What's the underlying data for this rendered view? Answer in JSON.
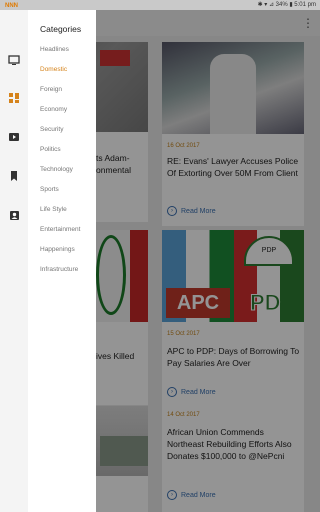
{
  "status": {
    "logo": "NNN",
    "right": "✱ ▾ ⊿ 34% ▮ 5:01 pm"
  },
  "drawer": {
    "title": "Categories",
    "items": [
      {
        "label": "Headlines",
        "active": false
      },
      {
        "label": "Domestic",
        "active": true
      },
      {
        "label": "Foreign",
        "active": false
      },
      {
        "label": "Economy",
        "active": false
      },
      {
        "label": "Security",
        "active": false
      },
      {
        "label": "Politics",
        "active": false
      },
      {
        "label": "Technology",
        "active": false
      },
      {
        "label": "Sports",
        "active": false
      },
      {
        "label": "Life Style",
        "active": false
      },
      {
        "label": "Entertainment",
        "active": false
      },
      {
        "label": "Happenings",
        "active": false
      },
      {
        "label": "Infrastructure",
        "active": false
      }
    ],
    "rail_icons": [
      "tv-icon",
      "grid-icon",
      "video-icon",
      "bookmark-icon",
      "account-icon"
    ]
  },
  "articles": {
    "left": [
      {
        "title_fragment": "ts Adam-\nonmental"
      },
      {
        "title_fragment": "ives Killed"
      }
    ],
    "right": [
      {
        "date": "16 Oct 2017",
        "title": "RE: Evans' Lawyer Accuses Police Of Extorting Over 50M From Client",
        "readmore": "Read More"
      },
      {
        "date": "15 Oct 2017",
        "title": "APC to PDP: Days of Borrowing To Pay Salaries Are Over",
        "readmore": "Read More"
      },
      {
        "date": "14 Oct 2017",
        "title": "African Union Commends Northeast Rebuilding Efforts Also Donates $100,000 to @NePcni",
        "readmore": "Read More"
      }
    ]
  },
  "colors": {
    "accent": "#d5831b",
    "link": "#3a6fb0"
  }
}
